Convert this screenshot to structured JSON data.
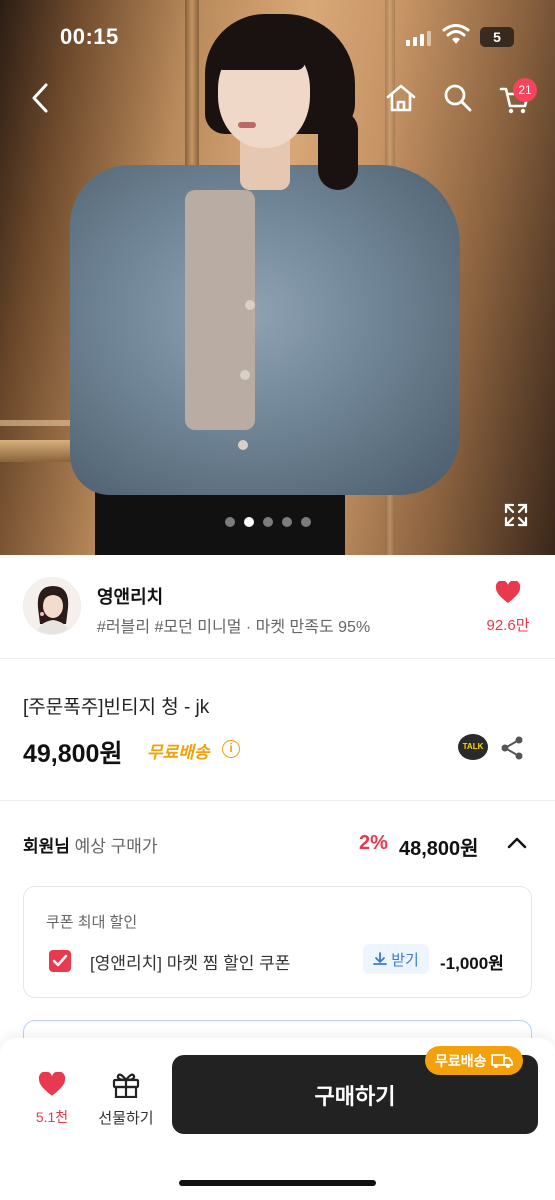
{
  "status_bar": {
    "time": "00:15",
    "battery": "5"
  },
  "header": {
    "cart_count": "21"
  },
  "gallery": {
    "dot_count": 5,
    "active_dot": 1
  },
  "shop": {
    "name": "영앤리치",
    "tags": "#러블리 #모던 미니멀 · 마켓 만족도 95%",
    "like_count": "92.6만"
  },
  "product": {
    "title": "[주문폭주]빈티지 청 - jk",
    "price": "49,800원",
    "shipping_badge": "무료배송",
    "talk_label": "TALK"
  },
  "member_price": {
    "label_bold": "회원님",
    "label_rest": " 예상 구매가",
    "rate": "2%",
    "price": "48,800원"
  },
  "coupon": {
    "heading": "쿠폰 최대 할인",
    "name": "[영앤리치] 마켓 찜 할인 쿠폰",
    "get_label": "받기",
    "amount": "-1,000원"
  },
  "bottom_bar": {
    "wish_count": "5.1천",
    "gift_label": "선물하기",
    "buy_label": "구매하기",
    "free_tag": "무료배송"
  },
  "colors": {
    "accent_red": "#e8394f",
    "accent_orange": "#f2a10b",
    "buy_button": "#222222"
  }
}
